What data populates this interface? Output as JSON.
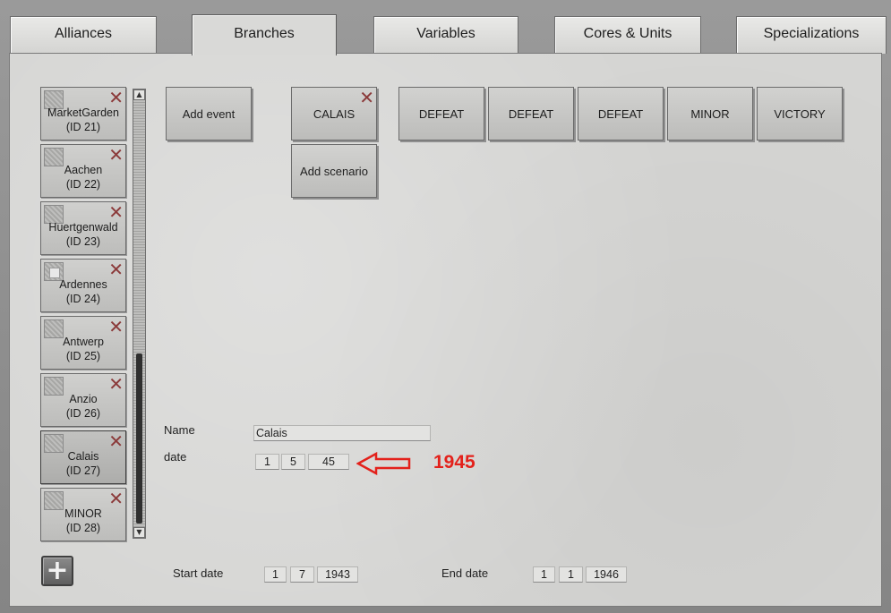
{
  "tabs": [
    {
      "label": "Alliances"
    },
    {
      "label": "Branches"
    },
    {
      "label": "Variables"
    },
    {
      "label": "Cores & Units"
    },
    {
      "label": "Specializations"
    }
  ],
  "active_tab": "Branches",
  "scenarios": [
    {
      "name": "MarketGarden",
      "id": "(ID 21)",
      "checked": false
    },
    {
      "name": "Aachen",
      "id": "(ID 22)",
      "checked": false
    },
    {
      "name": "Huertgenwald",
      "id": "(ID 23)",
      "checked": false
    },
    {
      "name": "Ardennes",
      "id": "(ID 24)",
      "checked": true
    },
    {
      "name": "Antwerp",
      "id": "(ID 25)",
      "checked": false
    },
    {
      "name": "Anzio",
      "id": "(ID 26)",
      "checked": false
    },
    {
      "name": "Calais",
      "id": "(ID 27)",
      "checked": false
    },
    {
      "name": "MINOR",
      "id": "(ID 28)",
      "checked": false
    }
  ],
  "selected_scenario": "Calais",
  "buttons": {
    "add_event": "Add event",
    "add_scenario": "Add scenario"
  },
  "events": [
    "CALAIS",
    "DEFEAT",
    "DEFEAT",
    "DEFEAT",
    "MINOR",
    "VICTORY"
  ],
  "form": {
    "name_label": "Name",
    "name_value": "Calais",
    "date_label": "date",
    "date": {
      "day": "1",
      "month": "5",
      "year": "45"
    },
    "start_label": "Start date",
    "start": {
      "day": "1",
      "month": "7",
      "year": "1943"
    },
    "end_label": "End date",
    "end": {
      "day": "1",
      "month": "1",
      "year": "1946"
    }
  },
  "annotation": {
    "text": "1945",
    "color": "#e3211b"
  },
  "icons": {
    "delete": "close-x-icon",
    "add": "plus-icon",
    "checkbox": "checkbox-icon"
  },
  "colors": {
    "delete_x": "#8b3a3a",
    "annotation": "#e3211b"
  }
}
